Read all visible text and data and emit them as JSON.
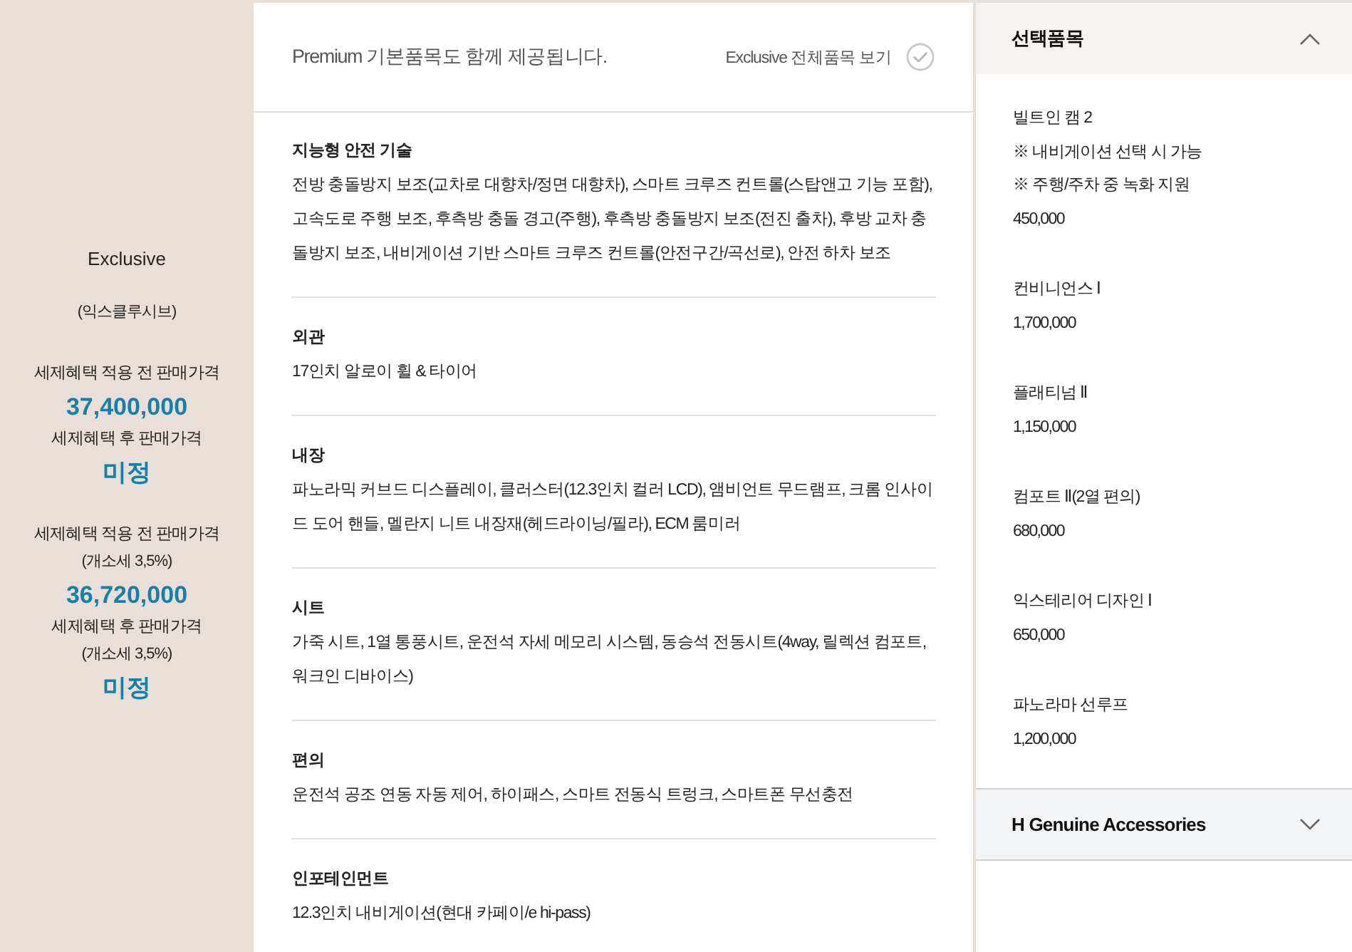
{
  "trim": {
    "name": "Exclusive",
    "subtitle": "(익스클루시브)",
    "price_groups": [
      {
        "lines": [
          {
            "kind": "label",
            "text": "세제혜택 적용 전 판매가격"
          },
          {
            "kind": "price",
            "text": "37,400,000"
          },
          {
            "kind": "label",
            "text": "세제혜택 후 판매가격"
          },
          {
            "kind": "price",
            "text": "미정"
          }
        ]
      },
      {
        "lines": [
          {
            "kind": "label",
            "text": "세제혜택 적용 전 판매가격"
          },
          {
            "kind": "note",
            "text": "(개소세 3,5%)"
          },
          {
            "kind": "price",
            "text": "36,720,000"
          },
          {
            "kind": "label",
            "text": "세제혜택 후 판매가격"
          },
          {
            "kind": "note",
            "text": "(개소세 3,5%)"
          },
          {
            "kind": "price",
            "text": "미정"
          }
        ]
      }
    ]
  },
  "basic_items": {
    "notice": "Premium 기본품목도 함께 제공됩니다.",
    "view_all_link": "Exclusive 전체품목 보기",
    "sections": [
      {
        "title": "지능형 안전 기술",
        "body": "전방 충돌방지 보조(교차로 대향차/정면 대향차), 스마트 크루즈 컨트롤(스탑앤고 기능 포함), 고속도로 주행 보조, 후측방 충돌 경고(주행), 후측방 충돌방지 보조(전진 출차), 후방 교차 충돌방지 보조, 내비게이션 기반 스마트 크루즈 컨트롤(안전구간/곡선로), 안전 하차 보조"
      },
      {
        "title": "외관",
        "body": "17인치 알로이 휠 & 타이어"
      },
      {
        "title": "내장",
        "body": "파노라믹 커브드 디스플레이, 클러스터(12.3인치 컬러 LCD), 앰비언트 무드램프, 크롬 인사이드 도어 핸들, 멜란지 니트 내장재(헤드라이닝/필라), ECM 룸미러"
      },
      {
        "title": "시트",
        "body": "가죽 시트, 1열 통풍시트, 운전석 자세 메모리 시스템, 동승석 전동시트(4way, 릴렉션 컴포트, 워크인 디바이스)"
      },
      {
        "title": "편의",
        "body": "운전석 공조 연동 자동 제어, 하이패스, 스마트 전동식 트렁크, 스마트폰 무선충전"
      },
      {
        "title": "인포테인먼트",
        "body": "12.3인치 내비게이션(현대 카페이/e hi-pass)"
      }
    ]
  },
  "options": {
    "panels": [
      {
        "title": "선택품목",
        "expanded": true,
        "items": [
          {
            "name": "빌트인 캠 2",
            "notes": [
              "※ 내비게이션 선택 시 가능",
              "※ 주행/주차 중 녹화 지원"
            ],
            "price": "450,000"
          },
          {
            "name": "컨비니언스 Ⅰ",
            "price": "1,700,000"
          },
          {
            "name": "플래티넘 Ⅱ",
            "price": "1,150,000"
          },
          {
            "name": "컴포트 Ⅱ(2열 편의)",
            "price": "680,000"
          },
          {
            "name": "익스테리어 디자인 Ⅰ",
            "price": "650,000"
          },
          {
            "name": "파노라마 선루프",
            "price": "1,200,000"
          }
        ]
      },
      {
        "title": "H Genuine Accessories",
        "expanded": false
      }
    ]
  }
}
